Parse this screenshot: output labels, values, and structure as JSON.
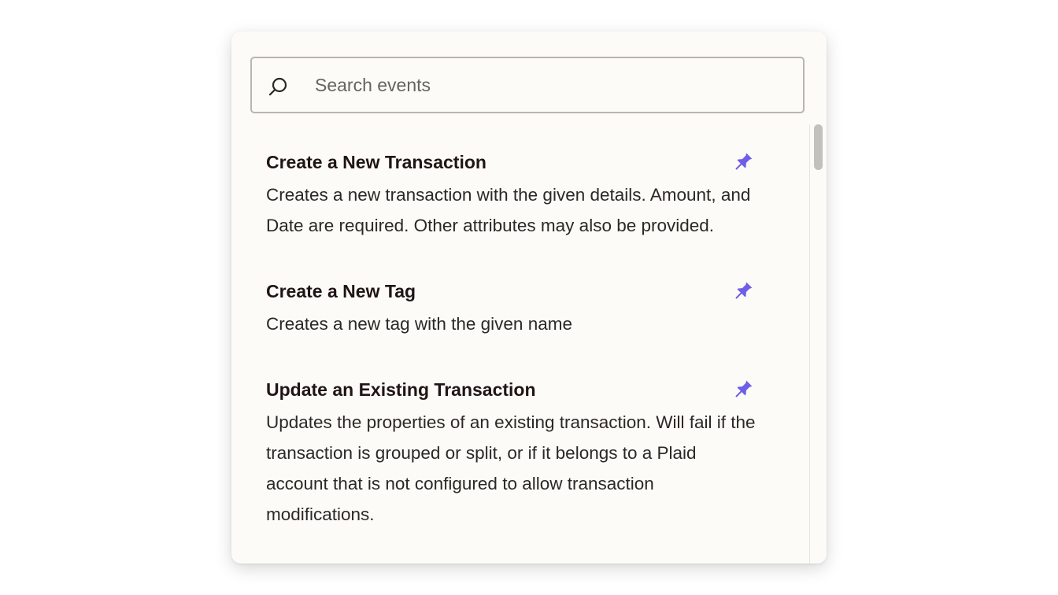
{
  "search": {
    "placeholder": "Search events",
    "value": "",
    "icon": "search-icon"
  },
  "events": [
    {
      "title": "Create a New Transaction",
      "description": "Creates a new transaction with the given details. Amount, and Date are required. Other attributes may also be provided.",
      "icon": "pin-icon"
    },
    {
      "title": "Create a New Tag",
      "description": "Creates a new tag with the given name",
      "icon": "pin-icon"
    },
    {
      "title": "Update an Existing Transaction",
      "description": "Updates the properties of an existing transaction. Will fail if the transaction is grouped or split, or if it belongs to a Plaid account that is not configured to allow transaction modifications.",
      "icon": "pin-icon"
    }
  ],
  "colors": {
    "accent": "#6e5ee8",
    "panel_background": "#fcfbf8",
    "border": "#b9b6ae",
    "title_text": "#201515"
  }
}
